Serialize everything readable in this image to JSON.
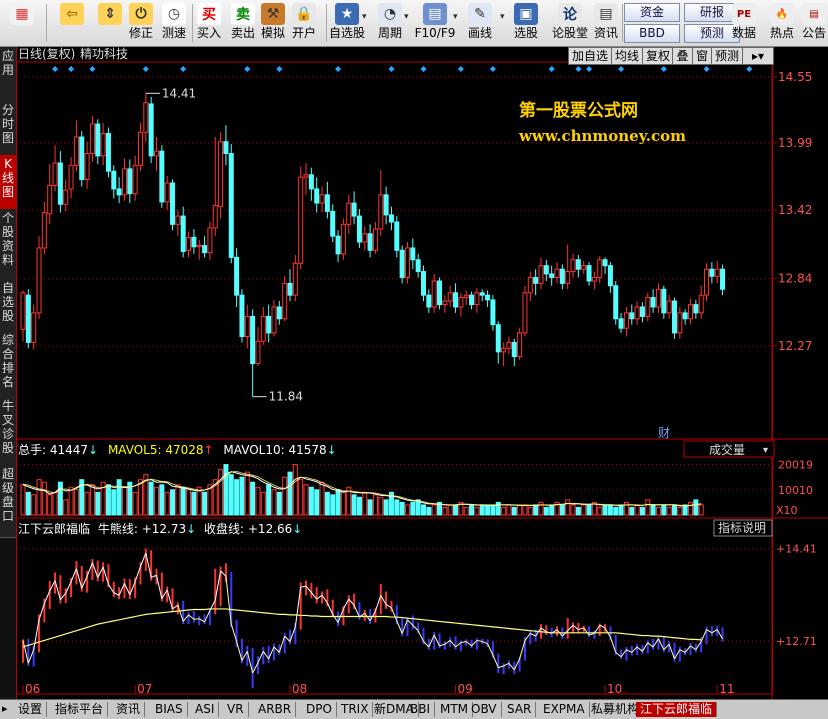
{
  "toolbar": {
    "items": [
      {
        "label": "",
        "icon": "windows-icon"
      },
      {
        "label": "",
        "icon": "back-arrow-icon"
      },
      {
        "label": "",
        "icon": "up-down-icon"
      },
      {
        "label": "修正",
        "icon": "fix-icon"
      },
      {
        "label": "测速",
        "icon": "speed-icon"
      },
      {
        "label": "买入",
        "icon": "buy-icon"
      },
      {
        "label": "卖出",
        "icon": "sell-icon"
      },
      {
        "label": "模拟",
        "icon": "simulate-icon"
      },
      {
        "label": "开户",
        "icon": "lock-icon"
      },
      {
        "label": "自选股",
        "icon": "star-icon"
      },
      {
        "label": "周期",
        "icon": "clock-icon"
      },
      {
        "label": "F10/F9",
        "icon": "f10-icon"
      },
      {
        "label": "画线",
        "icon": "pen-icon"
      },
      {
        "label": "选股",
        "icon": "select-icon"
      },
      {
        "label": "论股堂",
        "icon": "forum-icon"
      },
      {
        "label": "资讯",
        "icon": "news-icon"
      }
    ],
    "small_buttons": [
      "资金",
      "研报",
      "BBD",
      "预测"
    ],
    "right_items": [
      {
        "label": "数据",
        "icon": "pe-icon"
      },
      {
        "label": "热点",
        "icon": "hot-icon"
      },
      {
        "label": "公告",
        "icon": "notice-icon"
      }
    ],
    "dd_markers": [
      "▾",
      "▾",
      "▾",
      "▾"
    ]
  },
  "left_tabs": [
    "应用",
    "分时图",
    "K线图",
    "个股资料",
    "自选股",
    "综合排名",
    "牛叉诊股",
    "超级盘口"
  ],
  "chart_header": {
    "title": "日线(复权)",
    "stock": "精功科技",
    "buttons": [
      "加自选",
      "均线",
      "复权",
      "叠",
      "窗",
      "预测"
    ],
    "more": "▸▾"
  },
  "watermark": {
    "line1": "第一股票公式网",
    "line2": "www.chnmoney.com"
  },
  "volume_header": {
    "total_label": "总手: 41447",
    "mavol5_label": "MAVOL5: 47028",
    "mavol10_label": "MAVOL10: 41578",
    "arrow_down": "↓",
    "arrow_up": "↑",
    "selector": "成交量",
    "caret": "▾"
  },
  "indicator_header": {
    "name": "江下云郎福临",
    "cow_label": "牛熊线: +12.73",
    "close_label": "收盘线: +12.66",
    "arrow_down": "↓",
    "explain_button": "指标说明"
  },
  "bottom_tabs": [
    "设置",
    "指标平台",
    "资讯",
    "BIAS",
    "ASI",
    "VR",
    "ARBR",
    "DPO",
    "TRIX",
    "新DMA",
    "BBI",
    "MTM",
    "OBV",
    "SAR",
    "EXPMA",
    "私募机构",
    "江下云郎福临"
  ],
  "bottom_arrow": "▸",
  "finance_marker": "财",
  "colors": {
    "up": "#ff3232",
    "down": "#54ffff",
    "ma5": "#ffffff",
    "ma10": "#ffff00",
    "axis": "#b40000"
  },
  "chart_data": {
    "type": "candlestick",
    "price_axis": {
      "ticks": [
        14.55,
        13.99,
        13.42,
        12.84,
        12.27
      ],
      "range": [
        11.6,
        14.65
      ]
    },
    "annotations": {
      "high": 14.41,
      "low": 11.84
    },
    "x_labels": [
      {
        "label": "06",
        "index": 0
      },
      {
        "label": "07",
        "index": 21
      },
      {
        "label": "08",
        "index": 50
      },
      {
        "label": "09",
        "index": 81
      },
      {
        "label": "10",
        "index": 109
      },
      {
        "label": "11",
        "index": 130
      }
    ],
    "candles": [
      [
        12.41,
        12.72,
        12.31,
        12.74
      ],
      [
        12.7,
        12.3,
        12.25,
        12.75
      ],
      [
        12.3,
        12.55,
        12.24,
        12.62
      ],
      [
        12.55,
        13.1,
        12.5,
        13.2
      ],
      [
        13.1,
        13.4,
        13.05,
        13.49
      ],
      [
        13.39,
        13.63,
        13.3,
        13.81
      ],
      [
        13.63,
        13.82,
        13.58,
        13.97
      ],
      [
        13.82,
        13.47,
        13.4,
        13.92
      ],
      [
        13.47,
        13.59,
        13.41,
        13.68
      ],
      [
        13.6,
        13.8,
        13.52,
        13.87
      ],
      [
        13.8,
        14.04,
        13.75,
        14.18
      ],
      [
        14.04,
        13.68,
        13.62,
        14.09
      ],
      [
        13.68,
        13.9,
        13.6,
        14.0
      ],
      [
        13.9,
        14.15,
        13.83,
        14.22
      ],
      [
        14.15,
        13.88,
        13.81,
        14.19
      ],
      [
        13.88,
        14.07,
        13.8,
        14.16
      ],
      [
        14.07,
        13.75,
        13.7,
        14.12
      ],
      [
        13.75,
        13.6,
        13.52,
        13.8
      ],
      [
        13.6,
        13.55,
        13.48,
        13.7
      ],
      [
        13.55,
        13.77,
        13.5,
        13.86
      ],
      [
        13.77,
        13.56,
        13.48,
        13.85
      ],
      [
        13.56,
        13.8,
        13.5,
        13.88
      ],
      [
        13.8,
        14.08,
        13.75,
        14.16
      ],
      [
        14.08,
        14.33,
        14.0,
        14.41
      ],
      [
        14.32,
        13.88,
        13.82,
        14.38
      ],
      [
        13.88,
        13.92,
        13.75,
        14.04
      ],
      [
        13.92,
        13.49,
        13.44,
        13.97
      ],
      [
        13.49,
        13.65,
        13.42,
        13.71
      ],
      [
        13.65,
        13.3,
        13.25,
        13.68
      ],
      [
        13.3,
        13.37,
        13.2,
        13.42
      ],
      [
        13.37,
        13.07,
        13.02,
        13.45
      ],
      [
        13.08,
        13.19,
        13.02,
        13.24
      ],
      [
        13.19,
        13.11,
        13.05,
        13.26
      ],
      [
        13.11,
        13.12,
        13.0,
        13.17
      ],
      [
        13.12,
        13.06,
        13.02,
        13.2
      ],
      [
        13.06,
        13.27,
        13.0,
        13.32
      ],
      [
        13.27,
        13.46,
        13.2,
        14.04
      ],
      [
        13.45,
        14.0,
        13.35,
        14.08
      ],
      [
        14.0,
        13.9,
        13.8,
        14.14
      ],
      [
        13.9,
        13.02,
        12.97,
        13.98
      ],
      [
        13.02,
        12.7,
        12.6,
        13.1
      ],
      [
        12.7,
        12.35,
        12.3,
        12.75
      ],
      [
        12.35,
        12.52,
        12.25,
        12.62
      ],
      [
        12.52,
        12.12,
        11.84,
        12.58
      ],
      [
        12.12,
        12.31,
        12.1,
        12.43
      ],
      [
        12.31,
        12.52,
        12.28,
        12.6
      ],
      [
        12.52,
        12.38,
        12.3,
        12.62
      ],
      [
        12.38,
        12.6,
        12.35,
        12.66
      ],
      [
        12.6,
        12.5,
        12.45,
        12.65
      ],
      [
        12.5,
        12.8,
        12.48,
        12.86
      ],
      [
        12.8,
        12.7,
        12.65,
        12.92
      ],
      [
        12.7,
        12.97,
        12.65,
        13.04
      ],
      [
        12.97,
        13.7,
        12.92,
        13.79
      ],
      [
        13.7,
        13.72,
        13.55,
        13.82
      ],
      [
        13.72,
        13.6,
        13.5,
        13.78
      ],
      [
        13.6,
        13.48,
        13.4,
        13.7
      ],
      [
        13.48,
        13.55,
        13.4,
        13.62
      ],
      [
        13.55,
        13.41,
        13.35,
        13.66
      ],
      [
        13.41,
        13.2,
        13.15,
        13.47
      ],
      [
        13.2,
        13.05,
        12.98,
        13.25
      ],
      [
        13.05,
        13.3,
        13.0,
        13.35
      ],
      [
        13.3,
        13.48,
        13.22,
        13.55
      ],
      [
        13.48,
        13.37,
        13.3,
        13.58
      ],
      [
        13.37,
        13.15,
        13.1,
        13.43
      ],
      [
        13.15,
        13.22,
        13.08,
        13.28
      ],
      [
        13.22,
        13.08,
        13.02,
        13.3
      ],
      [
        13.08,
        13.26,
        13.05,
        13.32
      ],
      [
        13.26,
        13.55,
        13.2,
        13.76
      ],
      [
        13.55,
        13.38,
        13.3,
        13.62
      ],
      [
        13.38,
        13.32,
        13.25,
        13.45
      ],
      [
        13.32,
        13.08,
        13.02,
        13.37
      ],
      [
        13.08,
        12.85,
        12.8,
        13.12
      ],
      [
        12.85,
        13.1,
        12.8,
        13.15
      ],
      [
        13.1,
        13.0,
        12.92,
        13.18
      ],
      [
        13.0,
        12.9,
        12.85,
        13.05
      ],
      [
        12.9,
        12.7,
        12.65,
        12.95
      ],
      [
        12.7,
        12.6,
        12.55,
        12.75
      ],
      [
        12.6,
        12.82,
        12.55,
        12.88
      ],
      [
        12.82,
        12.62,
        12.58,
        12.85
      ],
      [
        12.62,
        12.65,
        12.55,
        12.7
      ],
      [
        12.65,
        12.72,
        12.6,
        12.78
      ],
      [
        12.72,
        12.6,
        12.55,
        12.8
      ],
      [
        12.6,
        12.68,
        12.52,
        12.72
      ],
      [
        12.68,
        12.7,
        12.62,
        12.74
      ],
      [
        12.7,
        12.62,
        12.58,
        12.73
      ],
      [
        12.62,
        12.72,
        12.55,
        12.76
      ],
      [
        12.72,
        12.7,
        12.65,
        12.75
      ],
      [
        12.7,
        12.66,
        12.6,
        12.74
      ],
      [
        12.66,
        12.45,
        12.4,
        12.7
      ],
      [
        12.45,
        12.22,
        12.12,
        12.48
      ],
      [
        12.22,
        12.25,
        12.1,
        12.3
      ],
      [
        12.25,
        12.3,
        12.2,
        12.35
      ],
      [
        12.3,
        12.18,
        12.1,
        12.33
      ],
      [
        12.18,
        12.38,
        12.15,
        12.42
      ],
      [
        12.38,
        12.72,
        12.35,
        12.78
      ],
      [
        12.72,
        12.85,
        12.65,
        12.9
      ],
      [
        12.85,
        12.8,
        12.7,
        12.92
      ],
      [
        12.8,
        12.95,
        12.75,
        13.02
      ],
      [
        12.95,
        12.88,
        12.82,
        13.0
      ],
      [
        12.88,
        12.85,
        12.78,
        12.95
      ],
      [
        12.85,
        12.92,
        12.8,
        12.98
      ],
      [
        12.92,
        12.8,
        12.75,
        12.96
      ],
      [
        12.8,
        12.9,
        12.75,
        13.13
      ],
      [
        12.9,
        13.0,
        12.85,
        13.05
      ],
      [
        13.0,
        12.92,
        12.85,
        13.04
      ],
      [
        12.92,
        12.95,
        12.88,
        12.99
      ],
      [
        12.95,
        12.82,
        12.78,
        12.98
      ],
      [
        12.82,
        12.85,
        12.75,
        12.9
      ],
      [
        12.85,
        13.0,
        12.8,
        13.03
      ],
      [
        13.0,
        12.95,
        12.88,
        13.02
      ],
      [
        12.95,
        12.78,
        12.72,
        12.98
      ],
      [
        12.78,
        12.5,
        12.45,
        12.82
      ],
      [
        12.5,
        12.42,
        12.38,
        12.55
      ],
      [
        12.42,
        12.55,
        12.35,
        12.6
      ],
      [
        12.55,
        12.5,
        12.45,
        12.62
      ],
      [
        12.5,
        12.6,
        12.45,
        12.65
      ],
      [
        12.6,
        12.52,
        12.47,
        12.64
      ],
      [
        12.52,
        12.68,
        12.48,
        12.72
      ],
      [
        12.68,
        12.6,
        12.55,
        12.75
      ],
      [
        12.6,
        12.75,
        12.55,
        12.8
      ],
      [
        12.75,
        12.55,
        12.5,
        12.78
      ],
      [
        12.55,
        12.65,
        12.5,
        12.7
      ],
      [
        12.65,
        12.38,
        12.33,
        12.68
      ],
      [
        12.38,
        12.55,
        12.33,
        12.6
      ],
      [
        12.55,
        12.5,
        12.45,
        12.58
      ],
      [
        12.5,
        12.62,
        12.45,
        12.67
      ],
      [
        12.62,
        12.55,
        12.5,
        12.66
      ],
      [
        12.55,
        12.7,
        12.5,
        12.78
      ],
      [
        12.7,
        12.92,
        12.65,
        12.97
      ],
      [
        12.92,
        12.86,
        12.8,
        12.98
      ],
      [
        12.86,
        12.92,
        12.8,
        12.99
      ],
      [
        12.92,
        12.75,
        12.7,
        12.96
      ]
    ],
    "volume": {
      "axis_ticks": [
        20019,
        10010
      ],
      "unit": "X10",
      "ymax": 23000,
      "values": [
        12000,
        9000,
        8000,
        14000,
        13000,
        8000,
        9000,
        13000,
        6000,
        11000,
        10000,
        14000,
        9000,
        12000,
        9000,
        13000,
        12000,
        10000,
        14000,
        11000,
        13000,
        9000,
        14000,
        16000,
        13000,
        11000,
        12000,
        9000,
        10000,
        12000,
        11000,
        10000,
        9000,
        11000,
        9000,
        12000,
        14000,
        18000,
        20000,
        16000,
        14000,
        15000,
        17000,
        13000,
        11000,
        9000,
        12000,
        10000,
        9000,
        15000,
        17000,
        20000,
        14000,
        12000,
        11000,
        10000,
        13000,
        9000,
        8000,
        10000,
        9000,
        11000,
        8000,
        7000,
        9000,
        6000,
        8000,
        7000,
        6000,
        9000,
        6000,
        5000,
        4000,
        5000,
        6000,
        4000,
        3000,
        4000,
        5000,
        3000,
        4000,
        4000,
        5000,
        3000,
        4000,
        3000,
        4000,
        4000,
        4000,
        5000,
        3000,
        4000,
        3000,
        4000,
        4000,
        3000,
        4000,
        5000,
        3000,
        4000,
        5000,
        4000,
        6000,
        4000,
        3000,
        4000,
        4000,
        5000,
        3000,
        4000,
        4000,
        3000,
        4000,
        5000,
        3000,
        4000,
        3000,
        6000,
        4000,
        3000,
        4000,
        3000,
        4000,
        3000,
        4000,
        5000,
        6000,
        4000
      ],
      "ma5": [
        12000,
        11200,
        10400,
        9900,
        9700,
        8300,
        8900,
        10700,
        9500,
        9800,
        10900,
        12000,
        11900,
        11000,
        10300,
        10900,
        11600,
        10900,
        11200,
        10900,
        11000,
        11600,
        12600,
        13900,
        14000,
        13000,
        13100,
        12800,
        11400,
        11100,
        10700,
        10300,
        9800,
        9500,
        9900,
        10600,
        12200,
        14100,
        16200,
        17200,
        16600,
        16000,
        15700,
        15300,
        14400,
        13000,
        12200,
        11000,
        10300,
        10400,
        11800,
        14200,
        15000,
        14300,
        13800,
        13200,
        12000,
        11300,
        10100,
        9700,
        9100,
        9500,
        8900,
        8800,
        8700,
        8700,
        8300,
        7800,
        7700,
        7400,
        7200,
        6500,
        5900,
        5600,
        5500,
        4800,
        4400,
        4400,
        4200,
        4000,
        3900,
        4000,
        4300,
        4200,
        4100,
        3900,
        4000,
        3800,
        3800,
        4000,
        4000,
        4000,
        3900,
        3800,
        3800,
        3800,
        3800,
        4000,
        3900,
        3800,
        4200,
        4200,
        4600,
        4400,
        4400,
        4200,
        4200,
        4400,
        4000,
        4000,
        4000,
        3800,
        3800,
        4000,
        4000,
        3800,
        3800,
        4200,
        4000,
        4000,
        4000,
        4000,
        4000,
        3600,
        3600,
        3800,
        4200,
        4400
      ]
    },
    "indicator": {
      "cow_line_value": 12.73,
      "close_line_value": 12.66,
      "axis_ticks": [
        14.41,
        12.71
      ],
      "cow_line": [
        12.6,
        12.63,
        12.66,
        12.69,
        12.72,
        12.75,
        12.78,
        12.81,
        12.84,
        12.87,
        12.9,
        12.93,
        12.96,
        12.99,
        13.02,
        13.04,
        13.06,
        13.08,
        13.1,
        13.12,
        13.14,
        13.16,
        13.18,
        13.2,
        13.21,
        13.22,
        13.23,
        13.24,
        13.25,
        13.26,
        13.27,
        13.28,
        13.29,
        13.29,
        13.29,
        13.3,
        13.3,
        13.3,
        13.3,
        13.29,
        13.28,
        13.27,
        13.26,
        13.25,
        13.24,
        13.23,
        13.22,
        13.21,
        13.2,
        13.2,
        13.19,
        13.19,
        13.18,
        13.18,
        13.17,
        13.17,
        13.16,
        13.16,
        13.16,
        13.16,
        13.16,
        13.16,
        13.16,
        13.16,
        13.16,
        13.16,
        13.16,
        13.16,
        13.16,
        13.15,
        13.15,
        13.14,
        13.13,
        13.12,
        13.11,
        13.1,
        13.09,
        13.08,
        13.07,
        13.06,
        13.05,
        13.04,
        13.03,
        13.02,
        13.01,
        13.0,
        12.99,
        12.98,
        12.97,
        12.96,
        12.95,
        12.94,
        12.93,
        12.92,
        12.91,
        12.9,
        12.89,
        12.88,
        12.87,
        12.86,
        12.86,
        12.86,
        12.86,
        12.86,
        12.86,
        12.86,
        12.86,
        12.86,
        12.86,
        12.86,
        12.86,
        12.86,
        12.85,
        12.84,
        12.83,
        12.82,
        12.81,
        12.81,
        12.8,
        12.8,
        12.79,
        12.78,
        12.77,
        12.76,
        12.75,
        12.74,
        12.74,
        12.73
      ]
    }
  }
}
